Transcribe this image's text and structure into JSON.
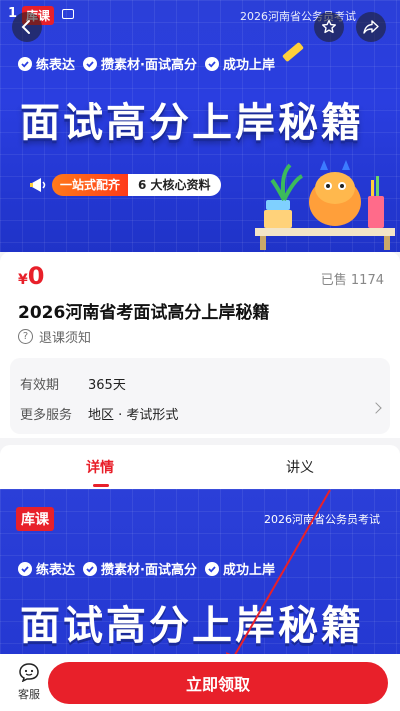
{
  "status": {
    "time": "1",
    "brand": "库课",
    "exam_caption": "2026河南省公务员考试"
  },
  "banner": {
    "tags": [
      "练表达",
      "攒素材·面试高分",
      "成功上岸"
    ],
    "title": "面试高分上岸秘籍",
    "pill_left": "一站式配齐",
    "pill_right": "6 大核心资料"
  },
  "product": {
    "currency": "¥",
    "price": "0",
    "sold": "已售 1174",
    "title": "2026河南省考面试高分上岸秘籍",
    "refund_label": "退课须知"
  },
  "details": {
    "validity_label": "有效期",
    "validity_value": "365天",
    "more_label": "更多服务",
    "more_value": "地区 · 考试形式"
  },
  "tabs": {
    "detail": "详情",
    "notes": "讲义"
  },
  "banner2": {
    "brand": "库课",
    "caption": "2026河南省公务员考试",
    "tags": [
      "练表达",
      "攒素材·面试高分",
      "成功上岸"
    ],
    "title": "面试高分上岸秘籍"
  },
  "bottom": {
    "service_label": "客服",
    "cta_label": "立即领取"
  },
  "colors": {
    "accent": "#e8202a",
    "banner_blue": "#2a3ee0"
  }
}
